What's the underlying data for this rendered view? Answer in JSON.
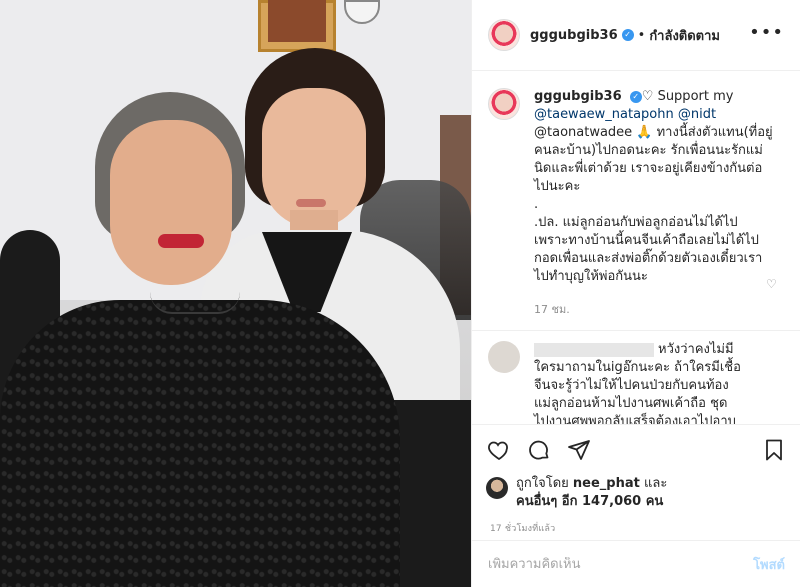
{
  "post": {
    "username": "gggubgib36",
    "verified_badge": "✓",
    "follow_label": "กำลังติดตาม",
    "more_label": "•••"
  },
  "caption": {
    "username": "gggubgib36",
    "lines": [
      "♡ Support my",
      "@taewaew_natapohn @nidt",
      "@taonatwadee 🙏 ทางนี้ส่งตัวแทน(ที่อยู่",
      "คนละบ้าน)ไปกอดนะคะ รักเพื่อนนะรักแม่",
      "นิดและพี่เต่าด้วย เราจะอยู่เคียงข้างกันต่อ",
      "ไปนะคะ",
      ".",
      ".ปล. แม่ลูกอ่อนกับพ่อลูกอ่อนไม่ได้ไป",
      "เพราะทางบ้านนี้คนจีนเค้าถือเลยไม่ได้ไป",
      "กอดเพื่อนและส่งพ่อติ๊กด้วยตัวเองเดี๋ยวเรา",
      "ไปทำบุญให้พ่อกันนะ"
    ],
    "time_ago": "17 ชม."
  },
  "comment": {
    "lines": [
      "หวังว่าคงไม่มี",
      "ใครมาถามในigอ๊กนะคะ ถ้าใครมีเชื้อ",
      "จีนจะรู้ว่าไม่ให้ไปคนป่วยกับคนท้อง",
      "แม่ลูกอ่อนห้ามไปงานศพเค้าถือ ชุด",
      "ไปงานศพพอกลับเสร็จต้องเอาไปอาบ"
    ],
    "heart_icon": "♡"
  },
  "likes": {
    "prefix": "ถูกใจโดย",
    "liker": "nee_phat",
    "and": "และ",
    "others": "คนอื่นๆ อีก 147,060 คน"
  },
  "posted_ago": "17 ชั่วโมงที่แล้ว",
  "add_comment": {
    "placeholder": "เพิ่มความคิดเห็น",
    "post_label": "โพสต์"
  },
  "colors": {
    "verified": "#3897f0",
    "mention": "#00376b",
    "post_disabled": "#b3dbff"
  }
}
